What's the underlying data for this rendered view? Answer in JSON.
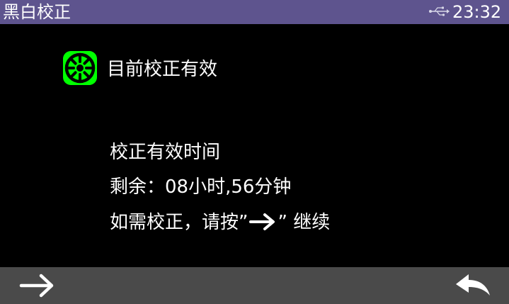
{
  "header": {
    "title": "黑白校正",
    "time": "23:32",
    "usb_icon": "usb-icon"
  },
  "status": {
    "icon": "calibration-wheel-icon",
    "icon_color": "#00ff00",
    "text": "目前校正有效"
  },
  "info": {
    "line1": "校正有效时间",
    "line2": "剩余：08小时,56分钟",
    "line3_prefix": "如需校正，请按”",
    "line3_suffix": "” 继续"
  },
  "footer": {
    "next_icon": "arrow-right-icon",
    "back_icon": "return-arrow-icon"
  },
  "colors": {
    "titlebar": "#5e548e",
    "background": "#000000",
    "bottombar": "#4a4a4a",
    "text": "#ffffff",
    "accent": "#00ff00"
  }
}
